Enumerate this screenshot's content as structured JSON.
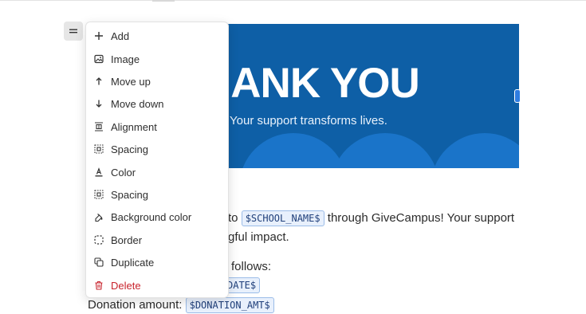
{
  "banner": {
    "title": "HANK YOU",
    "subtitle": "Your support transforms lives."
  },
  "body": {
    "line1_prefix": "to",
    "line1_token": "$SCHOOL_NAME$",
    "line1_suffix": "through GiveCampus! Your support",
    "line2": "gful impact.",
    "line3": "follows:",
    "line4_token": "DATE$",
    "line5_label": "Donation amount:",
    "line5_token": "$DONATION_AMT$"
  },
  "menu": {
    "items": [
      {
        "label": "Add",
        "icon": "plus-icon"
      },
      {
        "label": "Image",
        "icon": "image-icon"
      },
      {
        "label": "Move up",
        "icon": "arrow-up-icon"
      },
      {
        "label": "Move down",
        "icon": "arrow-down-icon"
      },
      {
        "label": "Alignment",
        "icon": "alignment-icon"
      },
      {
        "label": "Spacing",
        "icon": "spacing-icon"
      },
      {
        "label": "Color",
        "icon": "text-color-icon"
      },
      {
        "label": "Spacing",
        "icon": "spacing-icon"
      },
      {
        "label": "Background color",
        "icon": "paint-bucket-icon"
      },
      {
        "label": "Border",
        "icon": "border-icon"
      },
      {
        "label": "Duplicate",
        "icon": "duplicate-icon"
      },
      {
        "label": "Delete",
        "icon": "trash-icon"
      }
    ]
  },
  "colors": {
    "banner_bg": "#0e5fa6",
    "banner_circle": "#1a74c9",
    "danger": "#c8232c",
    "token_bg": "#e8f0fc"
  }
}
